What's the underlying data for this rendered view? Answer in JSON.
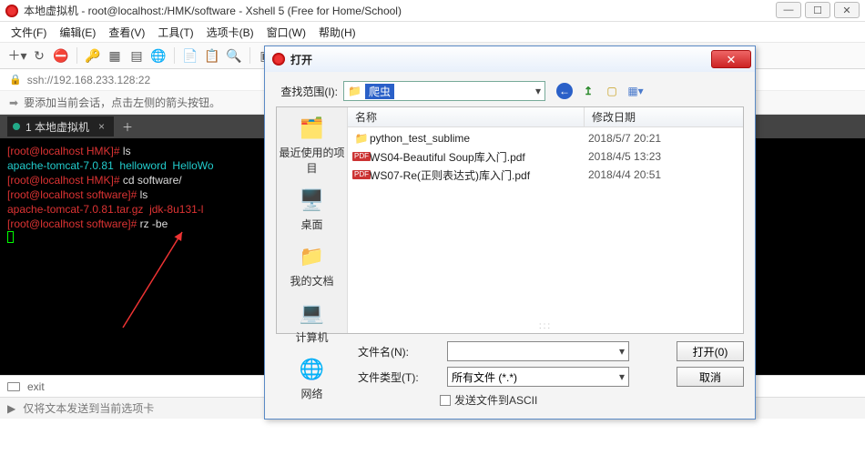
{
  "title": "本地虚拟机 - root@localhost:/HMK/software - Xshell 5 (Free for Home/School)",
  "menu": {
    "file": "文件(F)",
    "edit": "编辑(E)",
    "view": "查看(V)",
    "tool": "工具(T)",
    "tab": "选项卡(B)",
    "win": "窗口(W)",
    "help": "帮助(H)"
  },
  "addr": "ssh://192.168.233.128:22",
  "hint": "要添加当前会话，点击左侧的箭头按钮。",
  "tab_label": "1 本地虚拟机",
  "term": {
    "l1_prompt": "[root@localhost HMK]# ",
    "l1_cmd": "ls",
    "l2": "apache-tomcat-7.0.81  helloword  HelloWo",
    "l3_prompt": "[root@localhost HMK]# ",
    "l3_cmd": "cd software/",
    "l4_prompt": "[root@localhost software]# ",
    "l4_cmd": "ls",
    "l5": "apache-tomcat-7.0.81.tar.gz  jdk-8u131-l",
    "l6_prompt": "[root@localhost software]# ",
    "l6_cmd": "rz -be"
  },
  "bottom1": "exit",
  "bottom2": "仅将文本发送到当前选项卡",
  "dialog": {
    "title": "打开",
    "lookin_label": "查找范围(I):",
    "lookin_value": "爬虫",
    "cols": {
      "name": "名称",
      "date": "修改日期"
    },
    "sidebar": {
      "recent": "最近使用的项目",
      "desktop": "桌面",
      "docs": "我的文档",
      "computer": "计算机",
      "network": "网络"
    },
    "files": [
      {
        "icon": "folder",
        "name": "python_test_sublime",
        "date": "2018/5/7 20:21"
      },
      {
        "icon": "pdf",
        "name": "WS04-Beautiful Soup库入门.pdf",
        "date": "2018/4/5 13:23"
      },
      {
        "icon": "pdf",
        "name": "WS07-Re(正则表达式)库入门.pdf",
        "date": "2018/4/4 20:51"
      }
    ],
    "filename_label": "文件名(N):",
    "filetype_label": "文件类型(T):",
    "filetype_value": "所有文件 (*.*)",
    "open_btn": "打开(0)",
    "cancel_btn": "取消",
    "ascii_label": "发送文件到ASCII"
  }
}
